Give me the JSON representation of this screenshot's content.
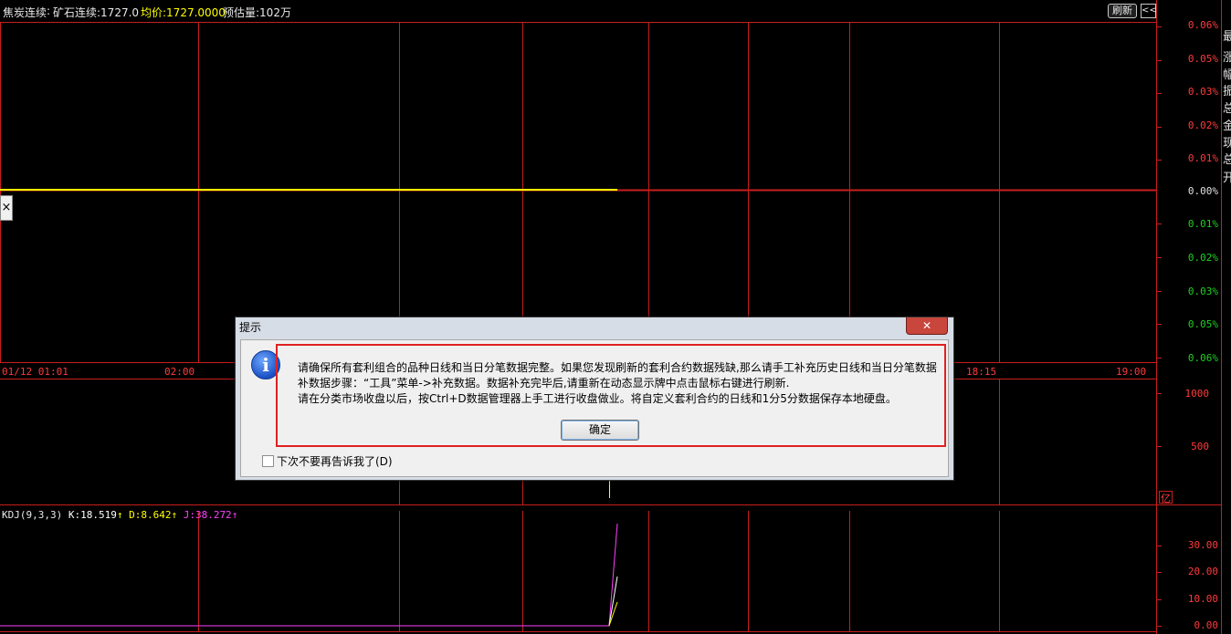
{
  "header": {
    "instrument": "焦炭连续",
    "colon1": ":",
    "ratio_label": "矿石连续:1727.0",
    "avg_label": "均价:1727.0000",
    "est_vol_label": "预估量:102万",
    "refresh_label": "刷新",
    "collapse_label": "<<"
  },
  "price_axis": [
    "0.06%",
    "0.05%",
    "0.03%",
    "0.02%",
    "0.01%",
    "0.00%",
    "0.01%",
    "0.02%",
    "0.03%",
    "0.05%",
    "0.06%"
  ],
  "time_axis": [
    "01/12 01:01",
    "02:00",
    "18:15",
    "19:00"
  ],
  "volume_axis": [
    "1000",
    "500"
  ],
  "kdj": {
    "name": "KDJ(9,3,3)",
    "k": "K:18.519",
    "d": "D:8.642",
    "j": "J:38.272",
    "arrow": "↑"
  },
  "kdj_axis": [
    "30.00",
    "20.00",
    "10.00",
    "0.00"
  ],
  "side_close": "×",
  "right_strip": [
    "最",
    "涨",
    "幅",
    "振",
    "总",
    "金",
    "现",
    "总",
    "开"
  ],
  "colors": {
    "grid": "#c81e1e",
    "up": "#ff3b3b",
    "down": "#20d020",
    "neutral": "#e0e0e0",
    "avg": "#ffff00",
    "k": "#ffffff",
    "d": "#ffff00",
    "j": "#ff40ff"
  },
  "dialog": {
    "title": "提示",
    "close": "✕",
    "icon": "info-icon",
    "line1": "请确保所有套利组合的品种日线和当日分笔数据完整。如果您发现刷新的套利合约数据残缺,那么请手工补充历史日线和当日分笔数据",
    "line2": "补数据步骤：“工具”菜单->补充数据。数据补充完毕后,请重新在动态显示牌中点击鼠标右键进行刷新.",
    "line3": "请在分类市场收盘以后，按Ctrl+D数据管理器上手工进行收盘做业。将自定义套利合约的日线和1分5分数据保存本地硬盘。",
    "ok": "确定",
    "checkbox_label": "下次不要再告诉我了(D)"
  }
}
